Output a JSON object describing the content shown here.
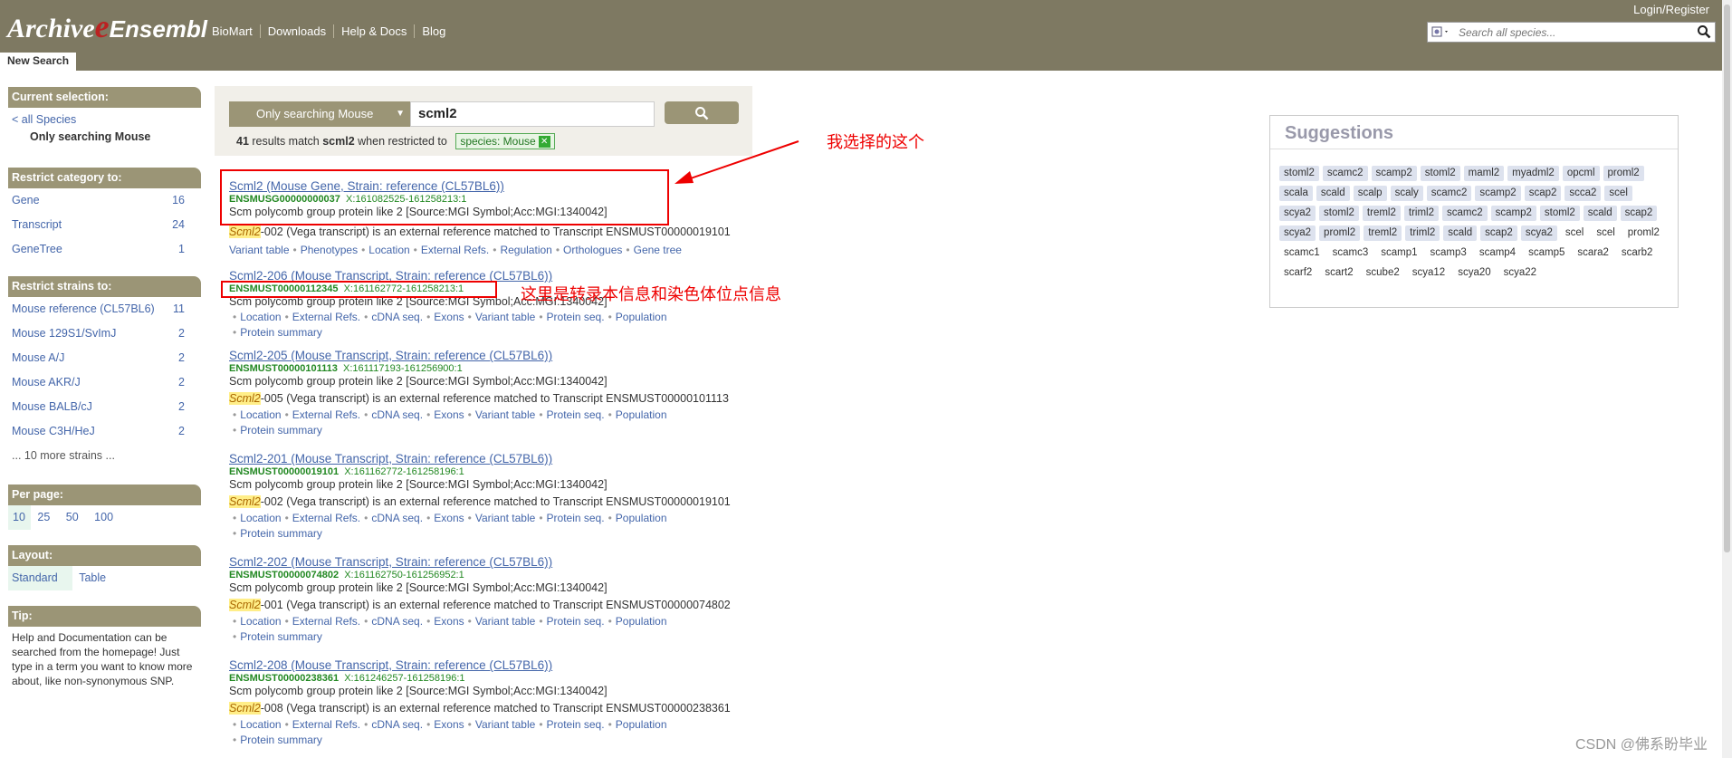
{
  "header": {
    "logo_archive": "Archive",
    "logo_ensembl": "Ensembl",
    "nav": [
      "BioMart",
      "Downloads",
      "Help & Docs",
      "Blog"
    ],
    "login": "Login/Register",
    "search_placeholder": "Search all species...",
    "tab": "New Search"
  },
  "left": {
    "current_selection": {
      "title": "Current selection:",
      "all_species": "< all Species",
      "only": "Only searching Mouse"
    },
    "category": {
      "title": "Restrict category to:",
      "items": [
        {
          "label": "Gene",
          "count": "16"
        },
        {
          "label": "Transcript",
          "count": "24"
        },
        {
          "label": "GeneTree",
          "count": "1"
        }
      ]
    },
    "strains": {
      "title": "Restrict strains to:",
      "items": [
        {
          "label": "Mouse reference (CL57BL6)",
          "count": "11"
        },
        {
          "label": "Mouse 129S1/SvImJ",
          "count": "2"
        },
        {
          "label": "Mouse A/J",
          "count": "2"
        },
        {
          "label": "Mouse AKR/J",
          "count": "2"
        },
        {
          "label": "Mouse BALB/cJ",
          "count": "2"
        },
        {
          "label": "Mouse C3H/HeJ",
          "count": "2"
        }
      ],
      "more": "... 10 more strains ..."
    },
    "per_page": {
      "title": "Per page:",
      "options": [
        "10",
        "25",
        "50",
        "100"
      ]
    },
    "layout": {
      "title": "Layout:",
      "options": [
        "Standard",
        "Table"
      ]
    },
    "tip": {
      "title": "Tip:",
      "text": "Help and Documentation can be searched from the homepage! Just type in a term you want to know more about, like non-synonymous SNP."
    }
  },
  "search": {
    "scope": "Only searching Mouse",
    "query": "scml2",
    "count": "41",
    "results_text": "results match",
    "term": "scml2",
    "when": "when restricted to",
    "filter": "species: Mouse"
  },
  "results": [
    {
      "title": "Scml2 (Mouse Gene, Strain: reference (CL57BL6))",
      "id": "ENSMUSG00000000037",
      "loc": "X:161082525-161258213:1",
      "desc": "Scm polycomb group protein like 2 [Source:MGI Symbol;Acc:MGI:1340042]",
      "ext_hl": "Scml2",
      "ext": "-002 (Vega transcript) is an external reference matched to Transcript ENSMUST00000019101",
      "links": [
        "Variant table",
        "Phenotypes",
        "Location",
        "External Refs.",
        "Regulation",
        "Orthologues",
        "Gene tree"
      ],
      "links2": []
    },
    {
      "title": "Scml2-206 (Mouse Transcript, Strain: reference (CL57BL6))",
      "id": "ENSMUST00000112345",
      "loc": "X:161162772-161258213:1",
      "desc": "Scm polycomb group protein like 2 [Source:MGI Symbol;Acc:MGI:1340042]",
      "ext_hl": "",
      "ext": "",
      "links": [
        "Location",
        "External Refs.",
        "cDNA seq.",
        "Exons",
        "Variant table",
        "Protein seq.",
        "Population"
      ],
      "links2": [
        "Protein summary"
      ]
    },
    {
      "title": "Scml2-205 (Mouse Transcript, Strain: reference (CL57BL6))",
      "id": "ENSMUST00000101113",
      "loc": "X:161117193-161256900:1",
      "desc": "Scm polycomb group protein like 2 [Source:MGI Symbol;Acc:MGI:1340042]",
      "ext_hl": "Scml2",
      "ext": "-005 (Vega transcript) is an external reference matched to Transcript ENSMUST00000101113",
      "links": [
        "Location",
        "External Refs.",
        "cDNA seq.",
        "Exons",
        "Variant table",
        "Protein seq.",
        "Population"
      ],
      "links2": [
        "Protein summary"
      ]
    },
    {
      "title": "Scml2-201 (Mouse Transcript, Strain: reference (CL57BL6))",
      "id": "ENSMUST00000019101",
      "loc": "X:161162772-161258196:1",
      "desc": "Scm polycomb group protein like 2 [Source:MGI Symbol;Acc:MGI:1340042]",
      "ext_hl": "Scml2",
      "ext": "-002 (Vega transcript) is an external reference matched to Transcript ENSMUST00000019101",
      "links": [
        "Location",
        "External Refs.",
        "cDNA seq.",
        "Exons",
        "Variant table",
        "Protein seq.",
        "Population"
      ],
      "links2": [
        "Protein summary"
      ]
    },
    {
      "title": "Scml2-202 (Mouse Transcript, Strain: reference (CL57BL6))",
      "id": "ENSMUST00000074802",
      "loc": "X:161162750-161256952:1",
      "desc": "Scm polycomb group protein like 2 [Source:MGI Symbol;Acc:MGI:1340042]",
      "ext_hl": "Scml2",
      "ext": "-001 (Vega transcript) is an external reference matched to Transcript ENSMUST00000074802",
      "links": [
        "Location",
        "External Refs.",
        "cDNA seq.",
        "Exons",
        "Variant table",
        "Protein seq.",
        "Population"
      ],
      "links2": [
        "Protein summary"
      ]
    },
    {
      "title": "Scml2-208 (Mouse Transcript, Strain: reference (CL57BL6))",
      "id": "ENSMUST00000238361",
      "loc": "X:161246257-161258196:1",
      "desc": "Scm polycomb group protein like 2 [Source:MGI Symbol;Acc:MGI:1340042]",
      "ext_hl": "Scml2",
      "ext": "-008 (Vega transcript) is an external reference matched to Transcript ENSMUST00000238361",
      "links": [
        "Location",
        "External Refs.",
        "cDNA seq.",
        "Exons",
        "Variant table",
        "Protein seq.",
        "Population"
      ],
      "links2": [
        "Protein summary"
      ]
    }
  ],
  "annotations": {
    "a1": "我选择的这个",
    "a2": "这里是转录本信息和染色体位点信息"
  },
  "suggestions": {
    "title": "Suggestions",
    "items": [
      "stoml2",
      "scamc2",
      "scamp2",
      "stoml2",
      "maml2",
      "myadml2",
      "opcml",
      "proml2",
      "scala",
      "scald",
      "scalp",
      "scaly",
      "scamc2",
      "scamp2",
      "scap2",
      "scca2",
      "scel",
      "scya2",
      "stoml2",
      "treml2",
      "triml2",
      "scamc2",
      "scamp2",
      "stoml2",
      "scald",
      "scap2",
      "scya2",
      "proml2",
      "treml2",
      "triml2",
      "scald",
      "scap2",
      "scya2",
      "scel",
      "scel",
      "proml2",
      "scamc1",
      "scamc3",
      "scamp1",
      "scamp3",
      "scamp4",
      "scamp5",
      "scara2",
      "scarb2",
      "scarf2",
      "scart2",
      "scube2",
      "scya12",
      "scya20",
      "scya22"
    ],
    "boxed_count": 33
  },
  "watermark": "CSDN @佛系盼毕业"
}
